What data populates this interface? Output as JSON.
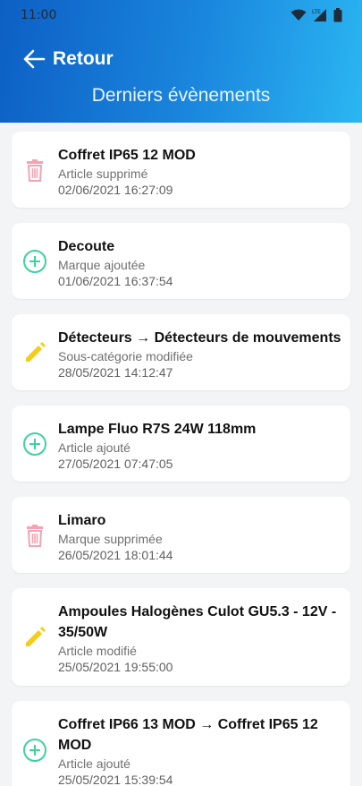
{
  "status_bar": {
    "time": "11:00",
    "network_label": "LTE"
  },
  "header": {
    "back_label": "Retour",
    "title": "Derniers évènements"
  },
  "events": [
    {
      "type": "delete",
      "icon": "trash-icon",
      "title": "Coffret IP65 12 MOD",
      "action": "Article supprimé",
      "date": "02/06/2021 16:27:09"
    },
    {
      "type": "add",
      "icon": "plus-circle-icon",
      "title": "Decoute",
      "action": "Marque ajoutée",
      "date": "01/06/2021 16:37:54"
    },
    {
      "type": "edit",
      "icon": "pencil-icon",
      "title": "Détecteurs → Détecteurs de mouvements",
      "action": "Sous-catégorie modifiée",
      "date": "28/05/2021 14:12:47"
    },
    {
      "type": "add",
      "icon": "plus-circle-icon",
      "title": "Lampe Fluo R7S 24W 118mm",
      "action": "Article ajouté",
      "date": "27/05/2021 07:47:05"
    },
    {
      "type": "delete",
      "icon": "trash-icon",
      "title": "Limaro",
      "action": "Marque supprimée",
      "date": "26/05/2021 18:01:44"
    },
    {
      "type": "edit",
      "icon": "pencil-icon",
      "title": "Ampoules Halogènes Culot GU5.3 - 12V - 35/50W",
      "action": "Article modifié",
      "date": "25/05/2021 19:55:00"
    },
    {
      "type": "add",
      "icon": "plus-circle-icon",
      "title": "Coffret IP66 13 MOD → Coffret IP65 12 MOD",
      "action": "Article ajouté",
      "date": "25/05/2021 15:39:54"
    }
  ],
  "colors": {
    "delete": "#f4a3b3",
    "add": "#3ed1a0",
    "edit": "#f5cc16"
  }
}
